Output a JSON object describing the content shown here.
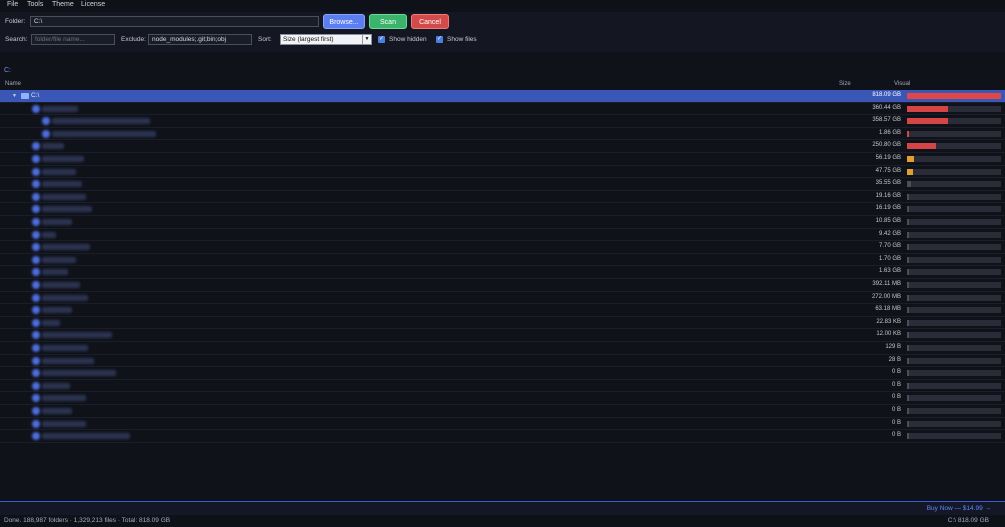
{
  "menu": [
    "File",
    "Tools",
    "Theme",
    "License"
  ],
  "toolbar": {
    "folder_label": "Folder:",
    "folder_value": "C:\\",
    "browse_label": "Browse...",
    "scan_label": "Scan",
    "cancel_label": "Cancel",
    "search_label": "Search:",
    "search_placeholder": "folder/file name...",
    "exclude_label": "Exclude:",
    "exclude_value": "node_modules;.git;bin;obj",
    "sort_label": "Sort:",
    "sort_value": "Size (largest first)",
    "show_hidden_label": "Show hidden",
    "show_hidden_checked": true,
    "show_files_label": "Show files",
    "show_files_checked": true
  },
  "breadcrumb": "C:",
  "table": {
    "headers": {
      "name": "Name",
      "size": "Size",
      "visual": "Visual"
    },
    "root": {
      "name": "C:\\",
      "size": "818.09 GB",
      "fraction": 1.0
    },
    "rows": [
      {
        "size": "360.44 GB",
        "fraction": 0.44,
        "color": "#d64545"
      },
      {
        "size": "358.57 GB",
        "fraction": 0.44,
        "color": "#d64545"
      },
      {
        "size": "1.86 GB",
        "fraction": 0.0,
        "color": "#d64545"
      },
      {
        "size": "250.80 GB",
        "fraction": 0.31,
        "color": "#d64545"
      },
      {
        "size": "56.19 GB",
        "fraction": 0.07,
        "color": "#e0a030"
      },
      {
        "size": "47.75 GB",
        "fraction": 0.06,
        "color": "#e0a030"
      },
      {
        "size": "35.55 GB",
        "fraction": 0.04,
        "color": "#4a4e5c"
      },
      {
        "size": "19.16 GB",
        "fraction": 0.02,
        "color": "#4a4e5c"
      },
      {
        "size": "16.19 GB",
        "fraction": 0.02,
        "color": "#4a4e5c"
      },
      {
        "size": "10.85 GB",
        "fraction": 0.01,
        "color": "#4a4e5c"
      },
      {
        "size": "9.42 GB",
        "fraction": 0.01,
        "color": "#4a4e5c"
      },
      {
        "size": "7.70 GB",
        "fraction": 0.01,
        "color": "#4a4e5c"
      },
      {
        "size": "1.70 GB",
        "fraction": 0.0,
        "color": "#4a4e5c"
      },
      {
        "size": "1.63 GB",
        "fraction": 0.0,
        "color": "#4a4e5c"
      },
      {
        "size": "392.11 MB",
        "fraction": 0.0,
        "color": "#4a4e5c"
      },
      {
        "size": "272.00 MB",
        "fraction": 0.0,
        "color": "#4a4e5c"
      },
      {
        "size": "63.18 MB",
        "fraction": 0.0,
        "color": "#4a4e5c"
      },
      {
        "size": "22.83 KB",
        "fraction": 0.0,
        "color": "#4a4e5c"
      },
      {
        "size": "12.00 KB",
        "fraction": 0.0,
        "color": "#4a4e5c"
      },
      {
        "size": "129 B",
        "fraction": 0.0,
        "color": "#4a4e5c"
      },
      {
        "size": "28 B",
        "fraction": 0.0,
        "color": "#4a4e5c"
      },
      {
        "size": "0 B",
        "fraction": 0.0,
        "color": "#4a4e5c"
      },
      {
        "size": "0 B",
        "fraction": 0.0,
        "color": "#4a4e5c"
      },
      {
        "size": "0 B",
        "fraction": 0.0,
        "color": "#4a4e5c"
      },
      {
        "size": "0 B",
        "fraction": 0.0,
        "color": "#4a4e5c"
      },
      {
        "size": "0 B",
        "fraction": 0.0,
        "color": "#4a4e5c"
      },
      {
        "size": "0 B",
        "fraction": 0.0,
        "color": "#4a4e5c"
      }
    ]
  },
  "buy_label": "Buy Now — $14.99 →",
  "status": {
    "left": "Done.  188,987 folders · 1,329,213 files · Total: 818.09 GB",
    "right": "C:\\   818.09 GB"
  }
}
